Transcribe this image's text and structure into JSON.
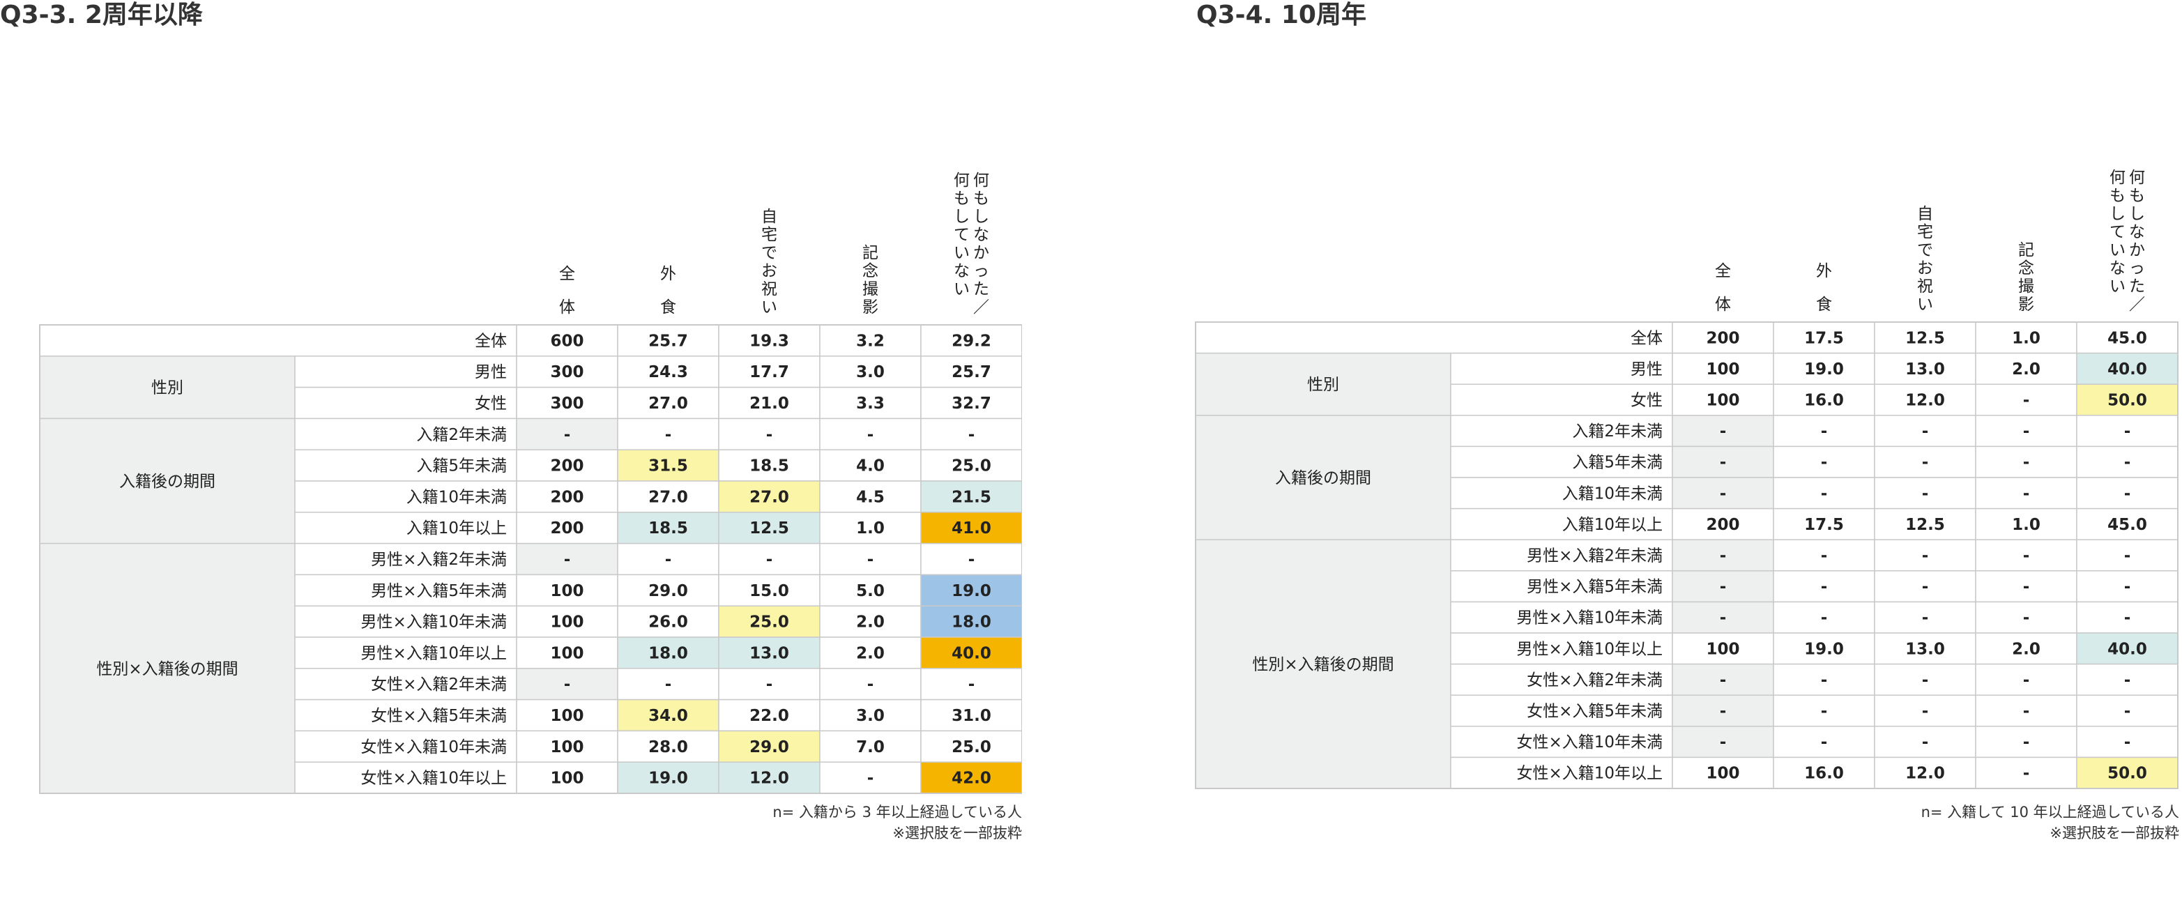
{
  "chart_data": [
    {
      "type": "table",
      "title": "Q3-3. 2周年以降",
      "columns": [
        "全体",
        "外食",
        "自宅でお祝い",
        "記念撮影",
        "何もしなかった／何もしていない"
      ],
      "total_row": {
        "label": "全体",
        "values": [
          "600",
          "25.7",
          "19.3",
          "3.2",
          "29.2"
        ]
      },
      "groups": [
        {
          "label": "性別",
          "rows": [
            {
              "label": "男性",
              "values": [
                "300",
                "24.3",
                "17.7",
                "3.0",
                "25.7"
              ],
              "highlights": [
                "",
                "",
                "",
                "",
                ""
              ]
            },
            {
              "label": "女性",
              "values": [
                "300",
                "27.0",
                "21.0",
                "3.3",
                "32.7"
              ],
              "highlights": [
                "",
                "",
                "",
                "",
                ""
              ]
            }
          ]
        },
        {
          "label": "入籍後の期間",
          "rows": [
            {
              "label": "入籍2年未満",
              "values": [
                "-",
                "-",
                "-",
                "-",
                "-"
              ],
              "highlights": [
                "gray",
                "",
                "",
                "",
                ""
              ]
            },
            {
              "label": "入籍5年未満",
              "values": [
                "200",
                "31.5",
                "18.5",
                "4.0",
                "25.0"
              ],
              "highlights": [
                "",
                "yellow",
                "",
                "",
                ""
              ]
            },
            {
              "label": "入籍10年未満",
              "values": [
                "200",
                "27.0",
                "27.0",
                "4.5",
                "21.5"
              ],
              "highlights": [
                "",
                "",
                "yellow",
                "",
                "teal"
              ]
            },
            {
              "label": "入籍10年以上",
              "values": [
                "200",
                "18.5",
                "12.5",
                "1.0",
                "41.0"
              ],
              "highlights": [
                "",
                "teal",
                "teal",
                "",
                "orange"
              ]
            }
          ]
        },
        {
          "label": "性別×入籍後の期間",
          "rows": [
            {
              "label": "男性×入籍2年未満",
              "values": [
                "-",
                "-",
                "-",
                "-",
                "-"
              ],
              "highlights": [
                "gray",
                "",
                "",
                "",
                ""
              ]
            },
            {
              "label": "男性×入籍5年未満",
              "values": [
                "100",
                "29.0",
                "15.0",
                "5.0",
                "19.0"
              ],
              "highlights": [
                "",
                "",
                "",
                "",
                "blue"
              ]
            },
            {
              "label": "男性×入籍10年未満",
              "values": [
                "100",
                "26.0",
                "25.0",
                "2.0",
                "18.0"
              ],
              "highlights": [
                "",
                "",
                "yellow",
                "",
                "blue"
              ]
            },
            {
              "label": "男性×入籍10年以上",
              "values": [
                "100",
                "18.0",
                "13.0",
                "2.0",
                "40.0"
              ],
              "highlights": [
                "",
                "teal",
                "teal",
                "",
                "orange"
              ]
            },
            {
              "label": "女性×入籍2年未満",
              "values": [
                "-",
                "-",
                "-",
                "-",
                "-"
              ],
              "highlights": [
                "gray",
                "",
                "",
                "",
                ""
              ]
            },
            {
              "label": "女性×入籍5年未満",
              "values": [
                "100",
                "34.0",
                "22.0",
                "3.0",
                "31.0"
              ],
              "highlights": [
                "",
                "yellow",
                "",
                "",
                ""
              ]
            },
            {
              "label": "女性×入籍10年未満",
              "values": [
                "100",
                "28.0",
                "29.0",
                "7.0",
                "25.0"
              ],
              "highlights": [
                "",
                "",
                "yellow",
                "",
                ""
              ]
            },
            {
              "label": "女性×入籍10年以上",
              "values": [
                "100",
                "19.0",
                "12.0",
                "-",
                "42.0"
              ],
              "highlights": [
                "",
                "teal",
                "teal",
                "",
                "orange"
              ]
            }
          ]
        }
      ],
      "notes": [
        "n= 入籍から 3 年以上経過している人",
        "※選択肢を一部抜粋"
      ]
    },
    {
      "type": "table",
      "title": "Q3-4. 10周年",
      "columns": [
        "全体",
        "外食",
        "自宅でお祝い",
        "記念撮影",
        "何もしなかった／何もしていない"
      ],
      "total_row": {
        "label": "全体",
        "values": [
          "200",
          "17.5",
          "12.5",
          "1.0",
          "45.0"
        ]
      },
      "groups": [
        {
          "label": "性別",
          "rows": [
            {
              "label": "男性",
              "values": [
                "100",
                "19.0",
                "13.0",
                "2.0",
                "40.0"
              ],
              "highlights": [
                "",
                "",
                "",
                "",
                "teal"
              ]
            },
            {
              "label": "女性",
              "values": [
                "100",
                "16.0",
                "12.0",
                "-",
                "50.0"
              ],
              "highlights": [
                "",
                "",
                "",
                "",
                "yellow"
              ]
            }
          ]
        },
        {
          "label": "入籍後の期間",
          "rows": [
            {
              "label": "入籍2年未満",
              "values": [
                "-",
                "-",
                "-",
                "-",
                "-"
              ],
              "highlights": [
                "gray",
                "",
                "",
                "",
                ""
              ]
            },
            {
              "label": "入籍5年未満",
              "values": [
                "-",
                "-",
                "-",
                "-",
                "-"
              ],
              "highlights": [
                "gray",
                "",
                "",
                "",
                ""
              ]
            },
            {
              "label": "入籍10年未満",
              "values": [
                "-",
                "-",
                "-",
                "-",
                "-"
              ],
              "highlights": [
                "gray",
                "",
                "",
                "",
                ""
              ]
            },
            {
              "label": "入籍10年以上",
              "values": [
                "200",
                "17.5",
                "12.5",
                "1.0",
                "45.0"
              ],
              "highlights": [
                "",
                "",
                "",
                "",
                ""
              ]
            }
          ]
        },
        {
          "label": "性別×入籍後の期間",
          "rows": [
            {
              "label": "男性×入籍2年未満",
              "values": [
                "-",
                "-",
                "-",
                "-",
                "-"
              ],
              "highlights": [
                "gray",
                "",
                "",
                "",
                ""
              ]
            },
            {
              "label": "男性×入籍5年未満",
              "values": [
                "-",
                "-",
                "-",
                "-",
                "-"
              ],
              "highlights": [
                "gray",
                "",
                "",
                "",
                ""
              ]
            },
            {
              "label": "男性×入籍10年未満",
              "values": [
                "-",
                "-",
                "-",
                "-",
                "-"
              ],
              "highlights": [
                "gray",
                "",
                "",
                "",
                ""
              ]
            },
            {
              "label": "男性×入籍10年以上",
              "values": [
                "100",
                "19.0",
                "13.0",
                "2.0",
                "40.0"
              ],
              "highlights": [
                "",
                "",
                "",
                "",
                "teal"
              ]
            },
            {
              "label": "女性×入籍2年未満",
              "values": [
                "-",
                "-",
                "-",
                "-",
                "-"
              ],
              "highlights": [
                "gray",
                "",
                "",
                "",
                ""
              ]
            },
            {
              "label": "女性×入籍5年未満",
              "values": [
                "-",
                "-",
                "-",
                "-",
                "-"
              ],
              "highlights": [
                "gray",
                "",
                "",
                "",
                ""
              ]
            },
            {
              "label": "女性×入籍10年未満",
              "values": [
                "-",
                "-",
                "-",
                "-",
                "-"
              ],
              "highlights": [
                "gray",
                "",
                "",
                "",
                ""
              ]
            },
            {
              "label": "女性×入籍10年以上",
              "values": [
                "100",
                "16.0",
                "12.0",
                "-",
                "50.0"
              ],
              "highlights": [
                "",
                "",
                "",
                "",
                "yellow"
              ]
            }
          ]
        }
      ],
      "notes": [
        "n= 入籍して 10 年以上経過している人",
        "※選択肢を一部抜粋"
      ]
    }
  ],
  "colors": {
    "gray": "#eef0ef",
    "yellow": "#fbf5a7",
    "teal": "#d7ecea",
    "orange": "#f5b400",
    "blue": "#9dc3e6",
    "group_fill": "#eef0ef",
    "border": "#c9c9c9"
  }
}
